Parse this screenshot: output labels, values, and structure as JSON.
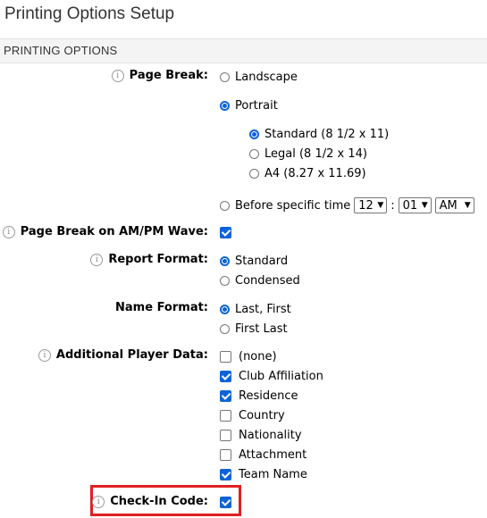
{
  "page": {
    "title": "Printing Options Setup",
    "section": "PRINTING OPTIONS"
  },
  "page_break": {
    "label": "Page Break:",
    "landscape": "Landscape",
    "portrait": "Portrait",
    "standard": "Standard (8 1/2 x 11)",
    "legal": "Legal (8 1/2 x 14)",
    "a4": "A4 (8.27 x 11.69)",
    "before_time": "Before specific time",
    "hour": "12",
    "minute": "01",
    "ampm": "AM",
    "colon": ":"
  },
  "wave": {
    "label": "Page Break on AM/PM Wave:",
    "checked": true
  },
  "report_format": {
    "label": "Report Format:",
    "standard": "Standard",
    "condensed": "Condensed"
  },
  "name_format": {
    "label": "Name Format:",
    "last_first": "Last, First",
    "first_last": "First Last"
  },
  "additional": {
    "label": "Additional Player Data:",
    "items": [
      "(none)",
      "Club Affiliation",
      "Residence",
      "Country",
      "Nationality",
      "Attachment",
      "Team Name"
    ]
  },
  "checkin": {
    "label": "Check-In Code:"
  },
  "icons": {
    "info": "i",
    "arrow": "▼"
  },
  "colors": {
    "accent": "#0a64d8",
    "highlight": "#e02020"
  }
}
